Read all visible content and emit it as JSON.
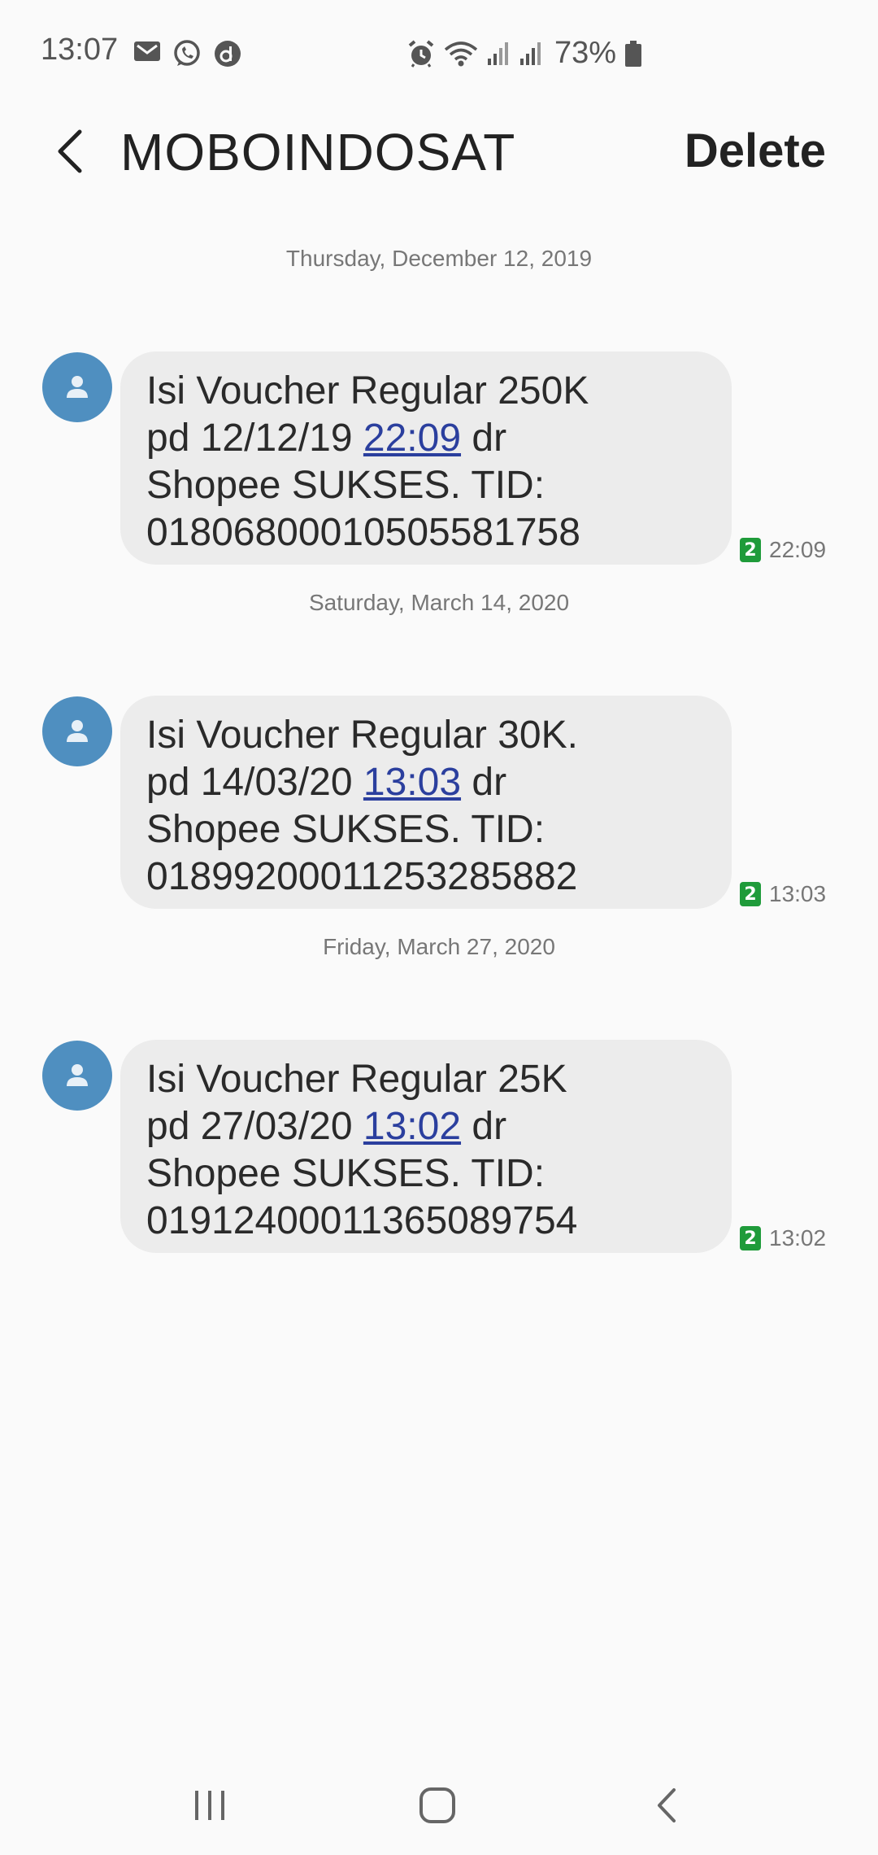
{
  "status_bar": {
    "time": "13:07",
    "battery": "73%",
    "left_icons": [
      "gmail-icon",
      "whatsapp-icon",
      "d-app-icon"
    ],
    "right_icons": [
      "alarm-icon",
      "wifi-icon",
      "signal-1-icon",
      "signal-2-icon",
      "battery-icon"
    ]
  },
  "header": {
    "title": "MOBOINDOSAT",
    "delete_label": "Delete",
    "back_icon": "back-arrow-icon"
  },
  "conversation": {
    "groups": [
      {
        "date": "Thursday, December 12, 2019",
        "message": {
          "line1": "Isi Voucher Regular 250K",
          "line2_prefix": "pd 12/12/19 ",
          "line2_link": "22:09",
          "line2_suffix": " dr",
          "line3": "Shopee SUKSES. TID:",
          "line4": "01806800010505581758"
        },
        "sim": "2",
        "time": "22:09"
      },
      {
        "date": "Saturday, March 14, 2020",
        "message": {
          "line1": "Isi Voucher Regular 30K.",
          "line2_prefix": "pd 14/03/20 ",
          "line2_link": "13:03",
          "line2_suffix": " dr",
          "line3": "Shopee SUKSES. TID:",
          "line4": "01899200011253285882"
        },
        "sim": "2",
        "time": "13:03"
      },
      {
        "date": "Friday, March 27, 2020",
        "message": {
          "line1": "Isi Voucher Regular 25K",
          "line2_prefix": "pd 27/03/20 ",
          "line2_link": "13:02",
          "line2_suffix": " dr",
          "line3": "Shopee SUKSES. TID:",
          "line4": "01912400011365089754"
        },
        "sim": "2",
        "time": "13:02"
      }
    ]
  },
  "nav_bar": {
    "buttons": [
      "recent-apps-icon",
      "home-icon",
      "back-icon"
    ]
  },
  "colors": {
    "avatar": "#4f8fc0",
    "bubble": "#ececec",
    "link": "#2b3f9e",
    "sim_badge": "#1f9b3a",
    "background": "#fafafa"
  }
}
